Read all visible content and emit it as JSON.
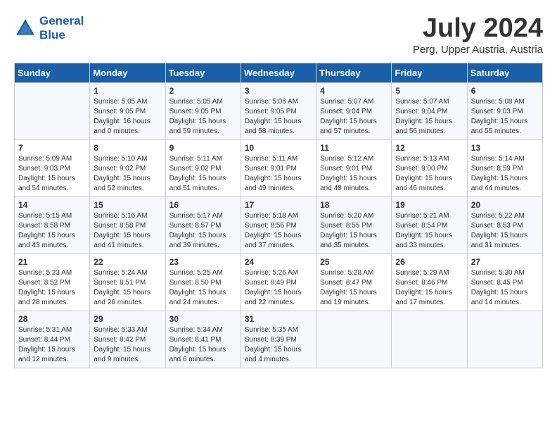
{
  "header": {
    "logo_line1": "General",
    "logo_line2": "Blue",
    "month_year": "July 2024",
    "location": "Perg, Upper Austria, Austria"
  },
  "days_of_week": [
    "Sunday",
    "Monday",
    "Tuesday",
    "Wednesday",
    "Thursday",
    "Friday",
    "Saturday"
  ],
  "weeks": [
    [
      {
        "day": "",
        "info": ""
      },
      {
        "day": "1",
        "info": "Sunrise: 5:05 AM\nSunset: 9:05 PM\nDaylight: 16 hours\nand 0 minutes."
      },
      {
        "day": "2",
        "info": "Sunrise: 5:05 AM\nSunset: 9:05 PM\nDaylight: 15 hours\nand 59 minutes."
      },
      {
        "day": "3",
        "info": "Sunrise: 5:06 AM\nSunset: 9:05 PM\nDaylight: 15 hours\nand 58 minutes."
      },
      {
        "day": "4",
        "info": "Sunrise: 5:07 AM\nSunset: 9:04 PM\nDaylight: 15 hours\nand 57 minutes."
      },
      {
        "day": "5",
        "info": "Sunrise: 5:07 AM\nSunset: 9:04 PM\nDaylight: 15 hours\nand 56 minutes."
      },
      {
        "day": "6",
        "info": "Sunrise: 5:08 AM\nSunset: 9:03 PM\nDaylight: 15 hours\nand 55 minutes."
      }
    ],
    [
      {
        "day": "7",
        "info": "Sunrise: 5:09 AM\nSunset: 9:03 PM\nDaylight: 15 hours\nand 54 minutes."
      },
      {
        "day": "8",
        "info": "Sunrise: 5:10 AM\nSunset: 9:02 PM\nDaylight: 15 hours\nand 52 minutes."
      },
      {
        "day": "9",
        "info": "Sunrise: 5:11 AM\nSunset: 9:02 PM\nDaylight: 15 hours\nand 51 minutes."
      },
      {
        "day": "10",
        "info": "Sunrise: 5:11 AM\nSunset: 9:01 PM\nDaylight: 15 hours\nand 49 minutes."
      },
      {
        "day": "11",
        "info": "Sunrise: 5:12 AM\nSunset: 9:01 PM\nDaylight: 15 hours\nand 48 minutes."
      },
      {
        "day": "12",
        "info": "Sunrise: 5:13 AM\nSunset: 9:00 PM\nDaylight: 15 hours\nand 46 minutes."
      },
      {
        "day": "13",
        "info": "Sunrise: 5:14 AM\nSunset: 8:59 PM\nDaylight: 15 hours\nand 44 minutes."
      }
    ],
    [
      {
        "day": "14",
        "info": "Sunrise: 5:15 AM\nSunset: 8:58 PM\nDaylight: 15 hours\nand 43 minutes."
      },
      {
        "day": "15",
        "info": "Sunrise: 5:16 AM\nSunset: 8:58 PM\nDaylight: 15 hours\nand 41 minutes."
      },
      {
        "day": "16",
        "info": "Sunrise: 5:17 AM\nSunset: 8:57 PM\nDaylight: 15 hours\nand 39 minutes."
      },
      {
        "day": "17",
        "info": "Sunrise: 5:18 AM\nSunset: 8:56 PM\nDaylight: 15 hours\nand 37 minutes."
      },
      {
        "day": "18",
        "info": "Sunrise: 5:20 AM\nSunset: 8:55 PM\nDaylight: 15 hours\nand 35 minutes."
      },
      {
        "day": "19",
        "info": "Sunrise: 5:21 AM\nSunset: 8:54 PM\nDaylight: 15 hours\nand 33 minutes."
      },
      {
        "day": "20",
        "info": "Sunrise: 5:22 AM\nSunset: 8:53 PM\nDaylight: 15 hours\nand 31 minutes."
      }
    ],
    [
      {
        "day": "21",
        "info": "Sunrise: 5:23 AM\nSunset: 8:52 PM\nDaylight: 15 hours\nand 28 minutes."
      },
      {
        "day": "22",
        "info": "Sunrise: 5:24 AM\nSunset: 8:51 PM\nDaylight: 15 hours\nand 26 minutes."
      },
      {
        "day": "23",
        "info": "Sunrise: 5:25 AM\nSunset: 8:50 PM\nDaylight: 15 hours\nand 24 minutes."
      },
      {
        "day": "24",
        "info": "Sunrise: 5:26 AM\nSunset: 8:49 PM\nDaylight: 15 hours\nand 22 minutes."
      },
      {
        "day": "25",
        "info": "Sunrise: 5:28 AM\nSunset: 8:47 PM\nDaylight: 15 hours\nand 19 minutes."
      },
      {
        "day": "26",
        "info": "Sunrise: 5:29 AM\nSunset: 8:46 PM\nDaylight: 15 hours\nand 17 minutes."
      },
      {
        "day": "27",
        "info": "Sunrise: 5:30 AM\nSunset: 8:45 PM\nDaylight: 15 hours\nand 14 minutes."
      }
    ],
    [
      {
        "day": "28",
        "info": "Sunrise: 5:31 AM\nSunset: 8:44 PM\nDaylight: 15 hours\nand 12 minutes."
      },
      {
        "day": "29",
        "info": "Sunrise: 5:33 AM\nSunset: 8:42 PM\nDaylight: 15 hours\nand 9 minutes."
      },
      {
        "day": "30",
        "info": "Sunrise: 5:34 AM\nSunset: 8:41 PM\nDaylight: 15 hours\nand 6 minutes."
      },
      {
        "day": "31",
        "info": "Sunrise: 5:35 AM\nSunset: 8:39 PM\nDaylight: 15 hours\nand 4 minutes."
      },
      {
        "day": "",
        "info": ""
      },
      {
        "day": "",
        "info": ""
      },
      {
        "day": "",
        "info": ""
      }
    ]
  ]
}
